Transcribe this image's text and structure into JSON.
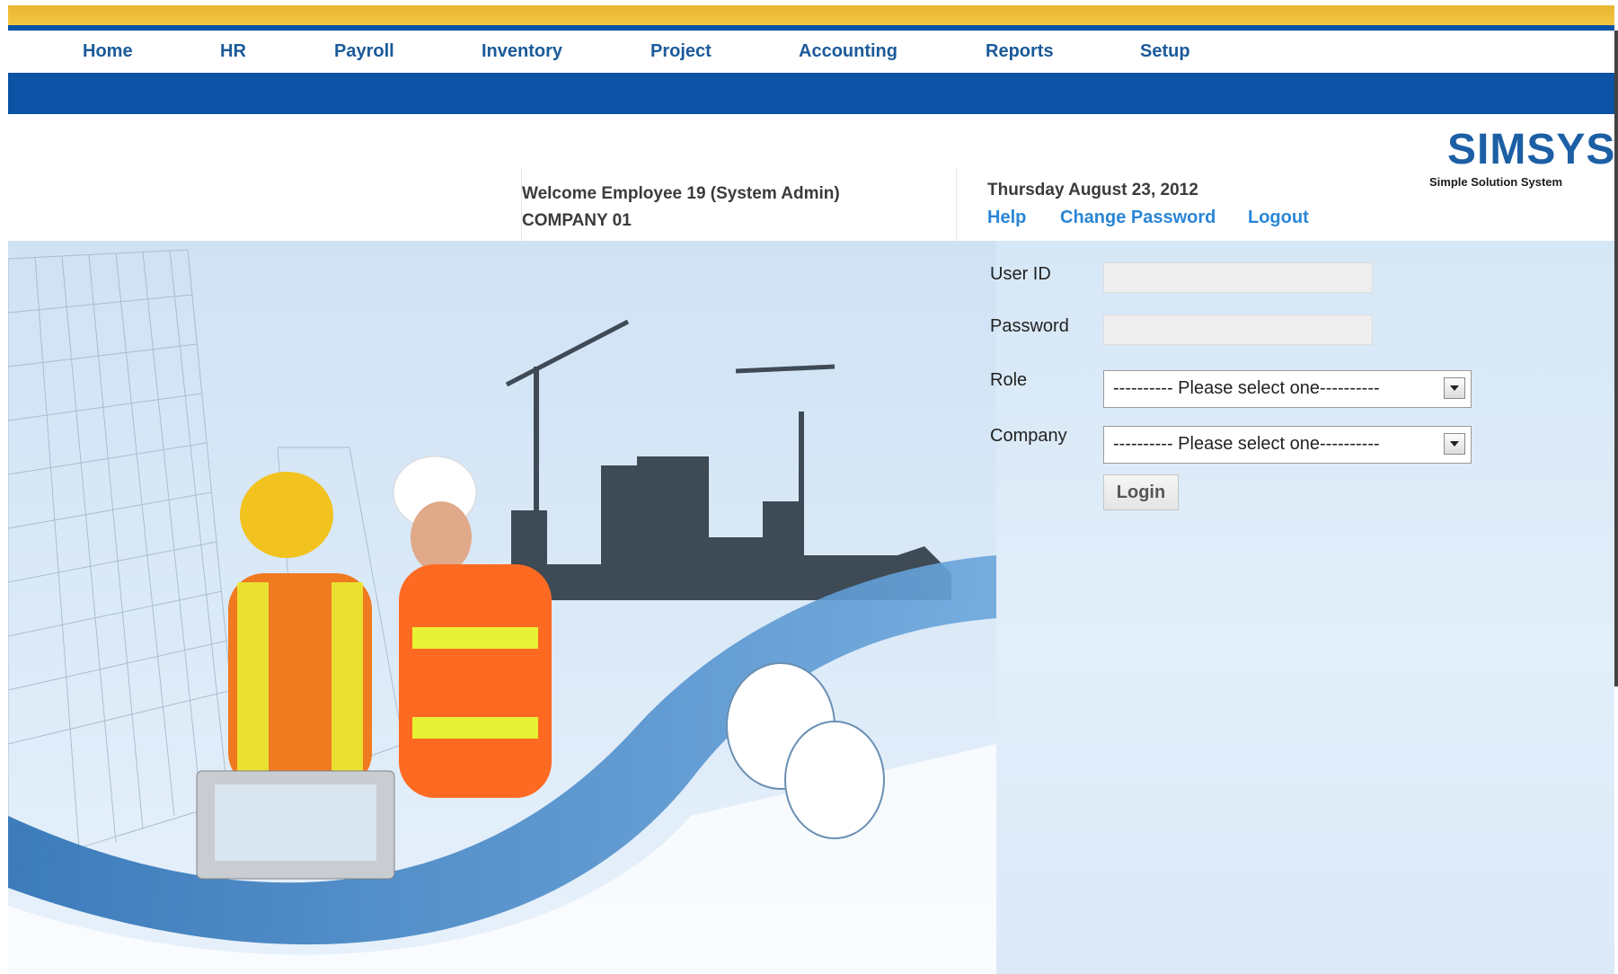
{
  "nav": {
    "items": [
      "Home",
      "HR",
      "Payroll",
      "Inventory",
      "Project",
      "Accounting",
      "Reports",
      "Setup"
    ]
  },
  "header": {
    "welcome_line": "Welcome Employee 19 (System Admin)",
    "company": "COMPANY 01",
    "date": "Thursday August 23, 2012",
    "links": {
      "help": "Help",
      "change_password": "Change Password",
      "logout": "Logout"
    }
  },
  "logo": {
    "brand": "SIMSYS",
    "tagline": "Simple Solution System"
  },
  "form": {
    "user_id_label": "User ID",
    "user_id_value": "",
    "password_label": "Password",
    "password_value": "",
    "role_label": "Role",
    "role_selected": "---------- Please select one----------",
    "company_label": "Company",
    "company_selected": "---------- Please select one----------",
    "login_label": "Login"
  },
  "colors": {
    "brand_blue": "#0c52a5",
    "gold": "#f5c842",
    "link_blue": "#2a86d6"
  },
  "hero": {
    "description_icon": "construction-workers-illustration"
  }
}
